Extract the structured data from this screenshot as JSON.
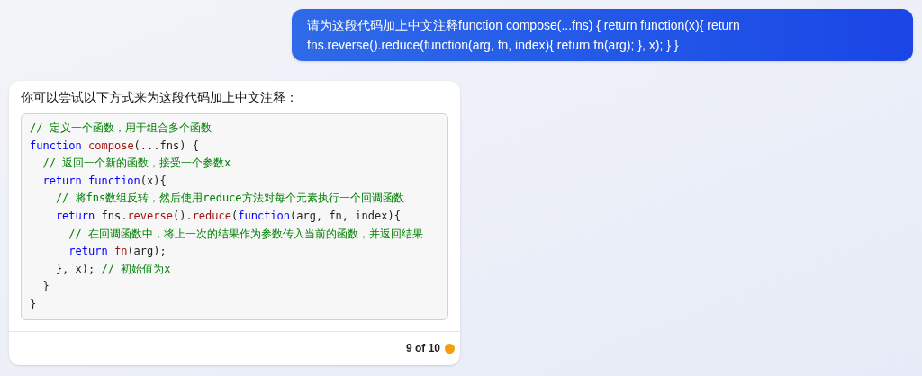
{
  "user_message": "请为这段代码加上中文注释function compose(...fns) { return function(x){ return fns.reverse().reduce(function(arg, fn, index){ return fn(arg); }, x); } }",
  "reply": {
    "intro": "你可以尝试以下方式来为这段代码加上中文注释：",
    "code_lines": [
      [
        {
          "kind": "comment",
          "text": "// 定义一个函数，用于组合多个函数"
        }
      ],
      [
        {
          "kind": "keyword",
          "text": "function "
        },
        {
          "kind": "name",
          "text": "compose"
        },
        {
          "kind": "plain",
          "text": "(...fns) {"
        }
      ],
      [
        {
          "kind": "comment",
          "text": "  // 返回一个新的函数，接受一个参数x"
        }
      ],
      [
        {
          "kind": "keyword",
          "text": "  return function"
        },
        {
          "kind": "plain",
          "text": "(x){"
        }
      ],
      [
        {
          "kind": "comment",
          "text": "    // 将fns数组反转，然后使用reduce方法对每个元素执行一个回调函数"
        }
      ],
      [
        {
          "kind": "keyword",
          "text": "    return"
        },
        {
          "kind": "plain",
          "text": " fns."
        },
        {
          "kind": "name",
          "text": "reverse"
        },
        {
          "kind": "plain",
          "text": "()."
        },
        {
          "kind": "name",
          "text": "reduce"
        },
        {
          "kind": "plain",
          "text": "("
        },
        {
          "kind": "keyword",
          "text": "function"
        },
        {
          "kind": "plain",
          "text": "(arg, fn, index){"
        }
      ],
      [
        {
          "kind": "comment",
          "text": "      // 在回调函数中，将上一次的结果作为参数传入当前的函数，并返回结果"
        }
      ],
      [
        {
          "kind": "keyword",
          "text": "      return "
        },
        {
          "kind": "name",
          "text": "fn"
        },
        {
          "kind": "plain",
          "text": "(arg);"
        }
      ],
      [
        {
          "kind": "plain",
          "text": "    }, x); "
        },
        {
          "kind": "comment",
          "text": "// 初始值为x"
        }
      ],
      [
        {
          "kind": "plain",
          "text": "  }"
        }
      ],
      [
        {
          "kind": "plain",
          "text": "}"
        }
      ]
    ],
    "counter": "9 of 10"
  }
}
